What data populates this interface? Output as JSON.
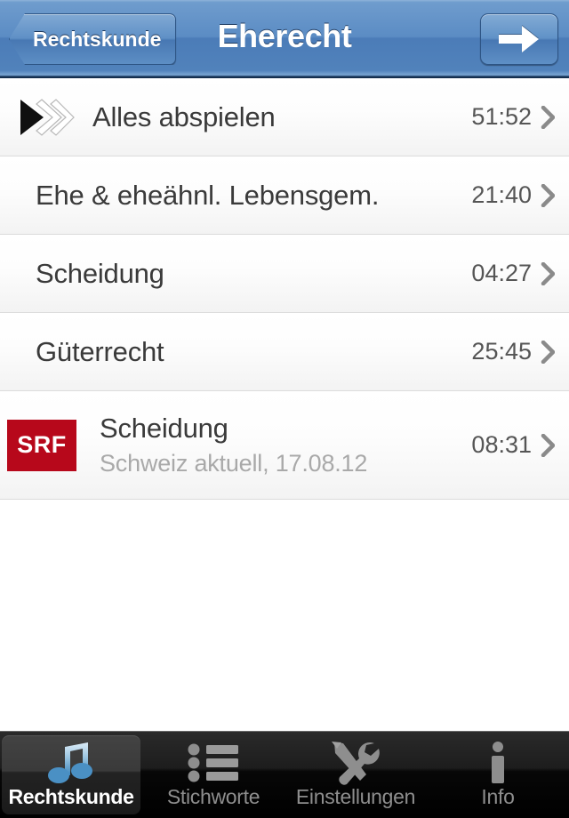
{
  "navbar": {
    "back_label": "Rechtskunde",
    "title": "Eherecht",
    "forward_icon": "arrow-right-icon"
  },
  "list": {
    "rows": [
      {
        "icon": "play-all-icon",
        "title": "Alles abspielen",
        "subtitle": "",
        "time": "51:52",
        "accessory": "chevron-right-icon"
      },
      {
        "icon": "",
        "title": "Ehe & eheähnl. Lebensgem.",
        "subtitle": "",
        "time": "21:40",
        "accessory": "chevron-right-icon"
      },
      {
        "icon": "",
        "title": "Scheidung",
        "subtitle": "",
        "time": "04:27",
        "accessory": "chevron-right-icon"
      },
      {
        "icon": "",
        "title": "Güterrecht",
        "subtitle": "",
        "time": "25:45",
        "accessory": "chevron-right-icon"
      },
      {
        "icon": "srf-logo-icon",
        "logo_text": "SRF",
        "title": "Scheidung",
        "subtitle": "Schweiz aktuell, 17.08.12",
        "time": "08:31",
        "accessory": "chevron-right-icon"
      }
    ]
  },
  "tabbar": {
    "tabs": [
      {
        "label": "Rechtskunde",
        "icon": "music-note-icon",
        "active": true
      },
      {
        "label": "Stichworte",
        "icon": "bulleted-list-icon",
        "active": false
      },
      {
        "label": "Einstellungen",
        "icon": "tools-icon",
        "active": false
      },
      {
        "label": "Info",
        "icon": "info-icon",
        "active": false
      }
    ]
  },
  "colors": {
    "navbar_blue": "#5b8cc4",
    "srf_red": "#b7081b",
    "active_tab_icon": "#4a90c4",
    "inactive_tab_icon": "#8e8e8e",
    "row_title": "#3a3a3a",
    "row_subtitle": "#a9a9a9"
  }
}
